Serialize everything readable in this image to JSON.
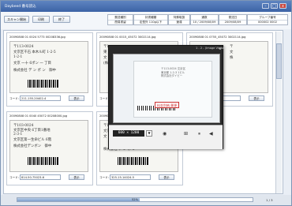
{
  "window": {
    "title": "Daybeed 番号読込",
    "min": "–",
    "max": "□",
    "close": "x"
  },
  "toolbar": {
    "buttons": [
      "スキャン開始",
      "印刷",
      "終了"
    ],
    "info": [
      {
        "header": "郵送種別",
        "value": "簡易書留"
      },
      {
        "header": "封書種類",
        "value": "定型外 110g以下"
      },
      {
        "header": "特殊取扱",
        "value": "速達"
      },
      {
        "header": "通数",
        "value": "10 / 2009/08/09"
      },
      {
        "header": "発送日",
        "value": "2009/08/09"
      },
      {
        "header": "グループ番号",
        "value": "000002 0002"
      }
    ]
  },
  "cards": [
    {
      "file": "20090808 01 0024 5773 00208336.jpg",
      "lines": [
        "〒113-0024",
        "文京区千石 本木ル町 1-2-5",
        "1-2-1",
        "文京 一十 6ポン 一 丁目",
        "株式会社 デ ン ポ ン　御中"
      ],
      "code_label": "コード:",
      "code": "211-155-20402-4",
      "btn": "表示"
    },
    {
      "file": "20090808 01 0015_45072 3002114.jpg",
      "lines": [
        "〒1",
        "東",
        "文",
        "(株"
      ],
      "code_label": "コード:",
      "code": "",
      "btn": "表示"
    },
    {
      "file": "20090808 01 0755_45072 3002114.jpg",
      "lines": [
        "〒",
        "文",
        "株"
      ],
      "code_label": "コード:",
      "code": "",
      "btn": "表示"
    },
    {
      "file": "20090808 01 0040 45072 00208000.jpg",
      "lines": [
        "〒103-0024",
        "文京区中央 6丁目1番地",
        "2-3-1",
        "文京区第一生命ビル 6階",
        "株式会社デンボン　御中"
      ],
      "code_label": "コード:",
      "code": "814-50-75023-6",
      "btn": "表示"
    },
    {
      "file": "20090808 01 0012 4090232 0002.jpg",
      "lines": [
        "〒1",
        "文京",
        "文",
        "株式会社 デ ン ポ ン"
      ],
      "code_label": "コード:",
      "code": "325-15-14024-5",
      "btn": "表示"
    }
  ],
  "viewer": {
    "title": "1 - 2 - (Image Viewer)",
    "close": "x",
    "addr": [
      "〒113-0024 文京区",
      "東京都 1-2-3 1ビル",
      "株式会社ダイビー"
    ],
    "stamp": "料金別納 郵便",
    "resolution": "600 × 1200",
    "res_drop": "▼",
    "icons": [
      "◉",
      "⊞",
      "⏸",
      "◀"
    ]
  },
  "statusbar": {
    "progress": 0.52,
    "progress_text": "52%",
    "page_count": "1 / 3"
  }
}
